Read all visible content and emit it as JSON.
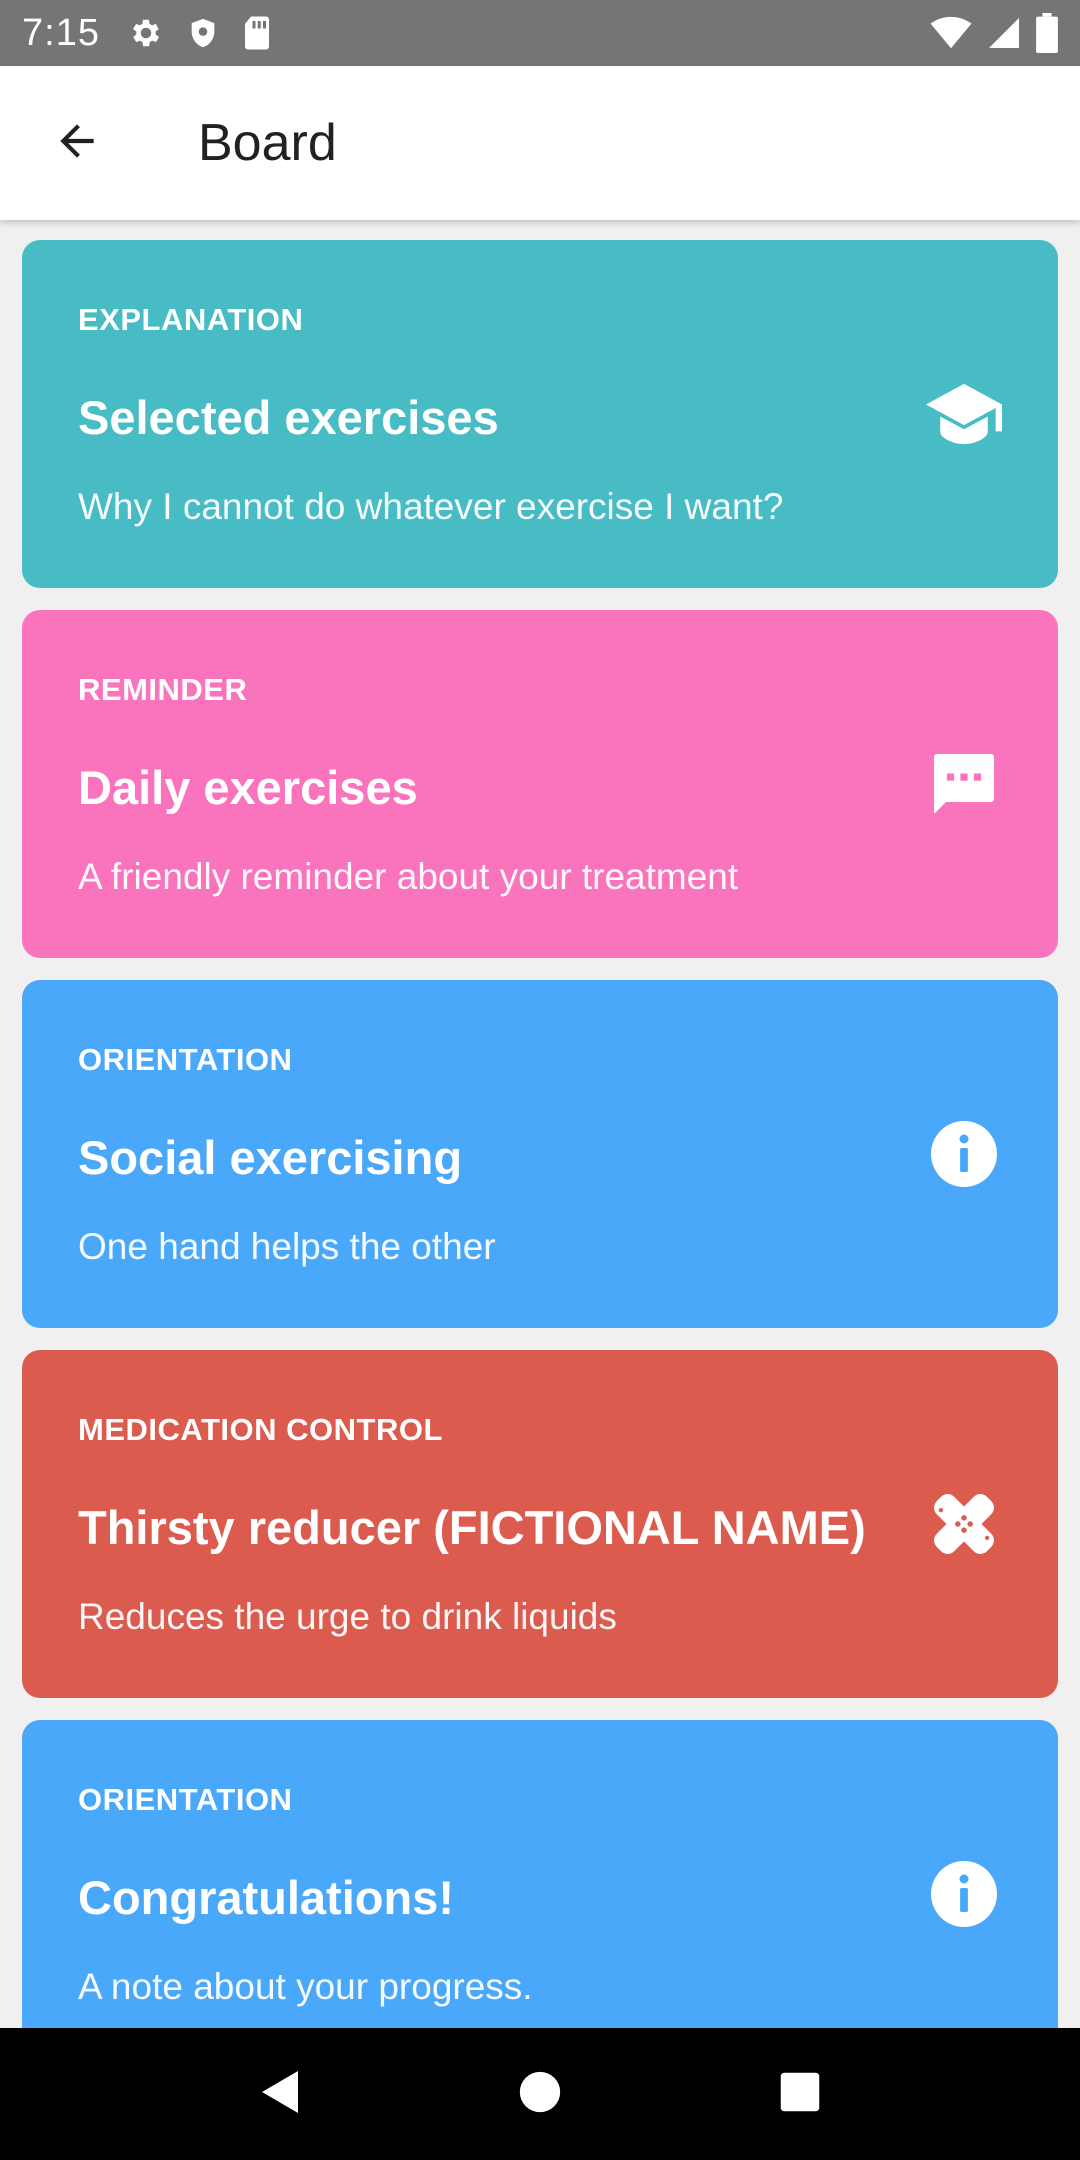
{
  "status_bar": {
    "time": "7:15",
    "left_icons": [
      "settings-icon",
      "shield-icon",
      "sd-card-icon"
    ],
    "right_icons": [
      "wifi-icon",
      "cell-signal-icon",
      "battery-icon"
    ]
  },
  "app_bar": {
    "back_icon": "arrow-back-icon",
    "title": "Board"
  },
  "cards": [
    {
      "category": "EXPLANATION",
      "title": "Selected exercises",
      "subtitle": "Why I cannot do whatever exercise I want?",
      "icon": "graduation-cap-icon",
      "color": "#47BCC5"
    },
    {
      "category": "REMINDER",
      "title": "Daily exercises",
      "subtitle": "A friendly reminder about your treatment",
      "icon": "chat-bubble-icon",
      "color": "#F974BC"
    },
    {
      "category": "ORIENTATION",
      "title": "Social exercising",
      "subtitle": "One hand helps the other",
      "icon": "info-icon",
      "color": "#4AA8FB"
    },
    {
      "category": "MEDICATION CONTROL",
      "title": "Thirsty reducer (FICTIONAL NAME)",
      "subtitle": "Reduces the urge to drink liquids",
      "icon": "bandage-icon",
      "color": "#DC5B4F"
    },
    {
      "category": "ORIENTATION",
      "title": "Congratulations!",
      "subtitle": "A note about your progress.",
      "icon": "info-icon",
      "color": "#4AA8FB"
    }
  ],
  "nav_bar": {
    "back": "nav-back-icon",
    "home": "nav-home-icon",
    "recents": "nav-recents-icon"
  }
}
